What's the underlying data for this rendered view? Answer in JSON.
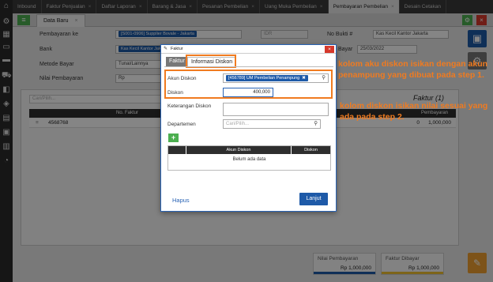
{
  "tabs": [
    {
      "label": "Inbound"
    },
    {
      "label": "Faktur Penjualan"
    },
    {
      "label": "Daftar Laporan"
    },
    {
      "label": "Barang & Jasa"
    },
    {
      "label": "Pesanan Pembelian"
    },
    {
      "label": "Uang Muka Pembelian"
    },
    {
      "label": "Pembayaran Pembelian"
    },
    {
      "label": "Desain Cetakan"
    }
  ],
  "tab_close": "×",
  "toolbar": {
    "subtab_label": "Data Baru",
    "list_icon": "list-icon"
  },
  "form": {
    "pemasok_label": "Pembayaran ke",
    "pemasok_value": "[S001-0906] Supplier Bovale - Jakarta",
    "currency_value": "IDR",
    "bank_label": "Bank",
    "bank_value": "Kas Kecil Kantor Jakar",
    "no_bukti_label": "No Bukti #",
    "no_bukti_value": "Kas Kecil Kantor Jakarta",
    "metode_label": "Metode Bayar",
    "metode_value": "Tunai/Lainnya",
    "tanggal_label": "Bayar",
    "tanggal_value": "25/03/2022",
    "nilai_label": "Nilai Pembayaran",
    "nilai_value": "Rp"
  },
  "detail": {
    "search_placeholder": "Cari/Pilih...",
    "faktur_count_label": "Faktur (1)",
    "col_no_faktur": "No. Faktur",
    "col_bayar": "Pembayaran",
    "row_no": "4568768",
    "row_val_mid": "0",
    "row_val": "1,000,000"
  },
  "summary": {
    "nilai_label": "Nilai Pembayaran",
    "nilai_value": "Rp 1,000,000",
    "faktur_label": "Faktur Dibayar",
    "faktur_value": "Rp 1,000,000"
  },
  "modal": {
    "title": "Faktur",
    "close": "×",
    "tab_faktur": "Faktur",
    "tab_info": "Informasi Diskon",
    "akun_label": "Akun Diskon",
    "akun_value": "[456789] UM Pembelian Penampung",
    "diskon_label": "Diskon",
    "diskon_value": "400,000",
    "keterangan_label": "Keterangan Diskon",
    "departemen_label": "Departemen",
    "departemen_placeholder": "Cari/Pilih...",
    "table_col_akun": "Akun Diskon",
    "table_col_diskon": "Diskon",
    "table_empty": "Belum ada data",
    "hapus": "Hapus",
    "lanjut": "Lanjut"
  },
  "notes": {
    "note1": "kolom aku diskon isikan dengan akun penampung yang dibuat pada step 1.",
    "note2": "kolom diskon isikan nilai sesuai yang ada pada step 2."
  },
  "colors": {
    "accent": "#1e5aa8",
    "highlight": "#f07b20",
    "green": "#4caf50"
  }
}
